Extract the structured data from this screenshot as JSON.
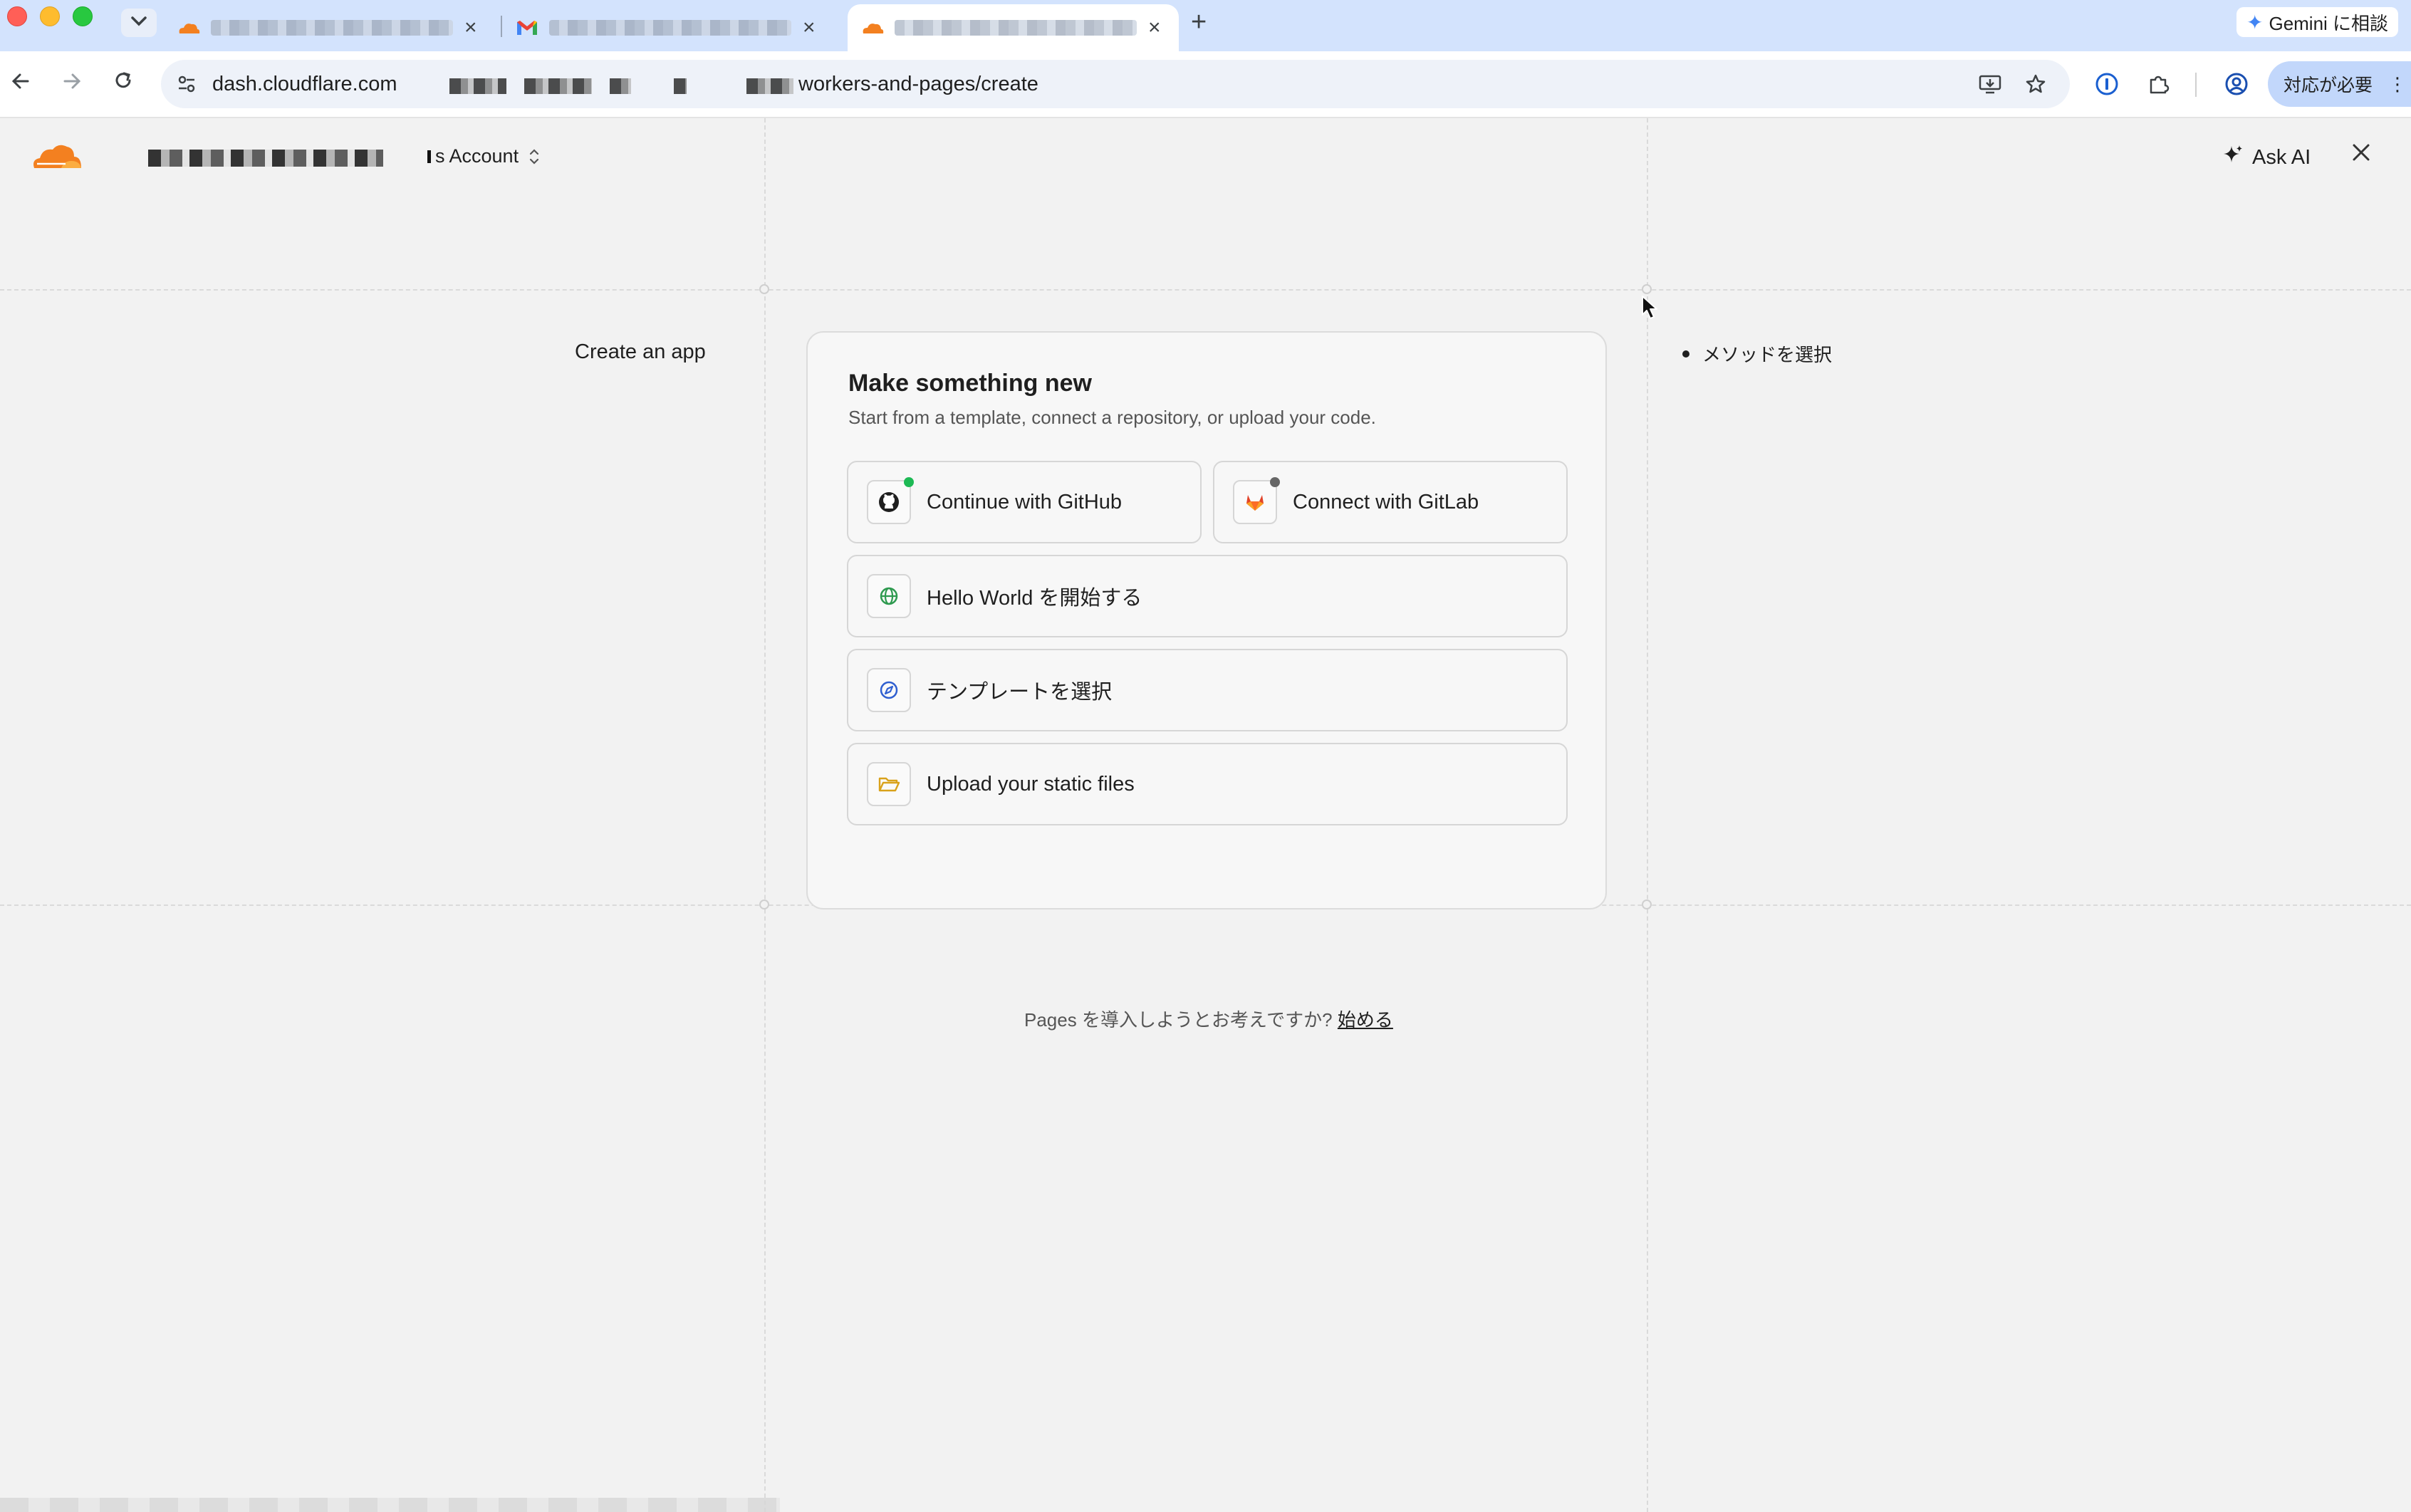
{
  "browser": {
    "tabs": [
      {
        "title": "",
        "favicon": "cloudflare-icon"
      },
      {
        "title": "",
        "favicon": "gmail-icon"
      },
      {
        "title": "",
        "favicon": "cloudflare-icon"
      }
    ],
    "new_tab_symbol": "+",
    "gemini_label": "Gemini に相談",
    "url_host": "dash.cloudflare.com",
    "url_path": "workers-and-pages/create",
    "attention_label": "対応が必要"
  },
  "header": {
    "account_label": "s Account",
    "ask_ai_label": "Ask AI"
  },
  "sidebar": {
    "title": "Create an app"
  },
  "card": {
    "title": "Make something new",
    "subtitle": "Start from a template, connect a repository, or upload your code.",
    "options": [
      {
        "label": "Continue with GitHub",
        "icon": "github-icon",
        "status_color": "#1db954"
      },
      {
        "label": "Connect with GitLab",
        "icon": "gitlab-icon",
        "status_color": "#666666"
      },
      {
        "label": "Hello World を開始する",
        "icon": "globe-icon"
      },
      {
        "label": "テンプレートを選択",
        "icon": "compass-icon"
      },
      {
        "label": "Upload your static files",
        "icon": "folder-icon"
      }
    ]
  },
  "footer_note": {
    "text": "Pages を導入しようとお考えですか?",
    "link": "始める"
  },
  "steps": [
    {
      "label": "メソッドを選択"
    }
  ],
  "colors": {
    "cloudflare_orange": "#f38020",
    "github_dot": "#1db954",
    "page_bg": "#f2f2f2"
  }
}
